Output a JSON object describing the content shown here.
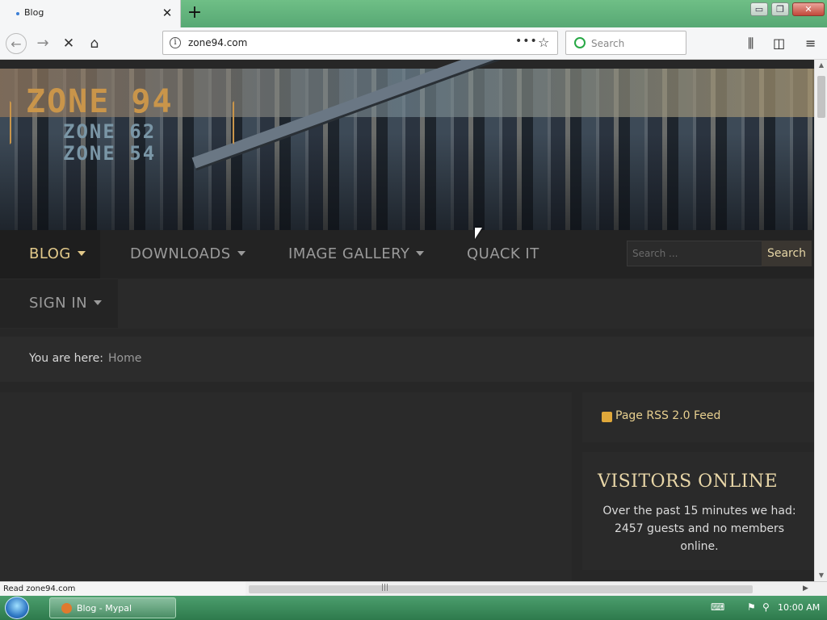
{
  "browser": {
    "tab_title": "Blog",
    "url": "zone94.com",
    "search_placeholder": "Search",
    "win_minimize": "▭",
    "win_restore": "❐",
    "win_close": "✕"
  },
  "site": {
    "logo_main": "ZONE 94",
    "logo_sub1": "ZONE 62",
    "logo_sub2": "ZONE 54",
    "menu": [
      {
        "label": "BLOG",
        "active": true,
        "has_caret": true
      },
      {
        "label": "DOWNLOADS",
        "active": false,
        "has_caret": true
      },
      {
        "label": "IMAGE GALLERY",
        "active": false,
        "has_caret": true
      },
      {
        "label": "QUACK IT",
        "active": false,
        "has_caret": false
      },
      {
        "label": "SIGN IN",
        "active": false,
        "has_caret": true
      }
    ],
    "search_placeholder": "Search ...",
    "search_button": "Search",
    "breadcrumb_label": "You are here:",
    "breadcrumb_home": "Home",
    "rss_link": "Page RSS 2.0 Feed",
    "visitors_title": "VISITORS ONLINE",
    "visitors_text": "Over the past 15 minutes we had: 2457 guests and no members online."
  },
  "status": {
    "text": "Read zone94.com"
  },
  "taskbar": {
    "task_label": "Blog - Mypal",
    "clock": "10:00 AM"
  },
  "colors": {
    "accent_gold": "#e2c98a",
    "page_bg": "#272727",
    "taskbar_green": "#3b8a5c"
  }
}
